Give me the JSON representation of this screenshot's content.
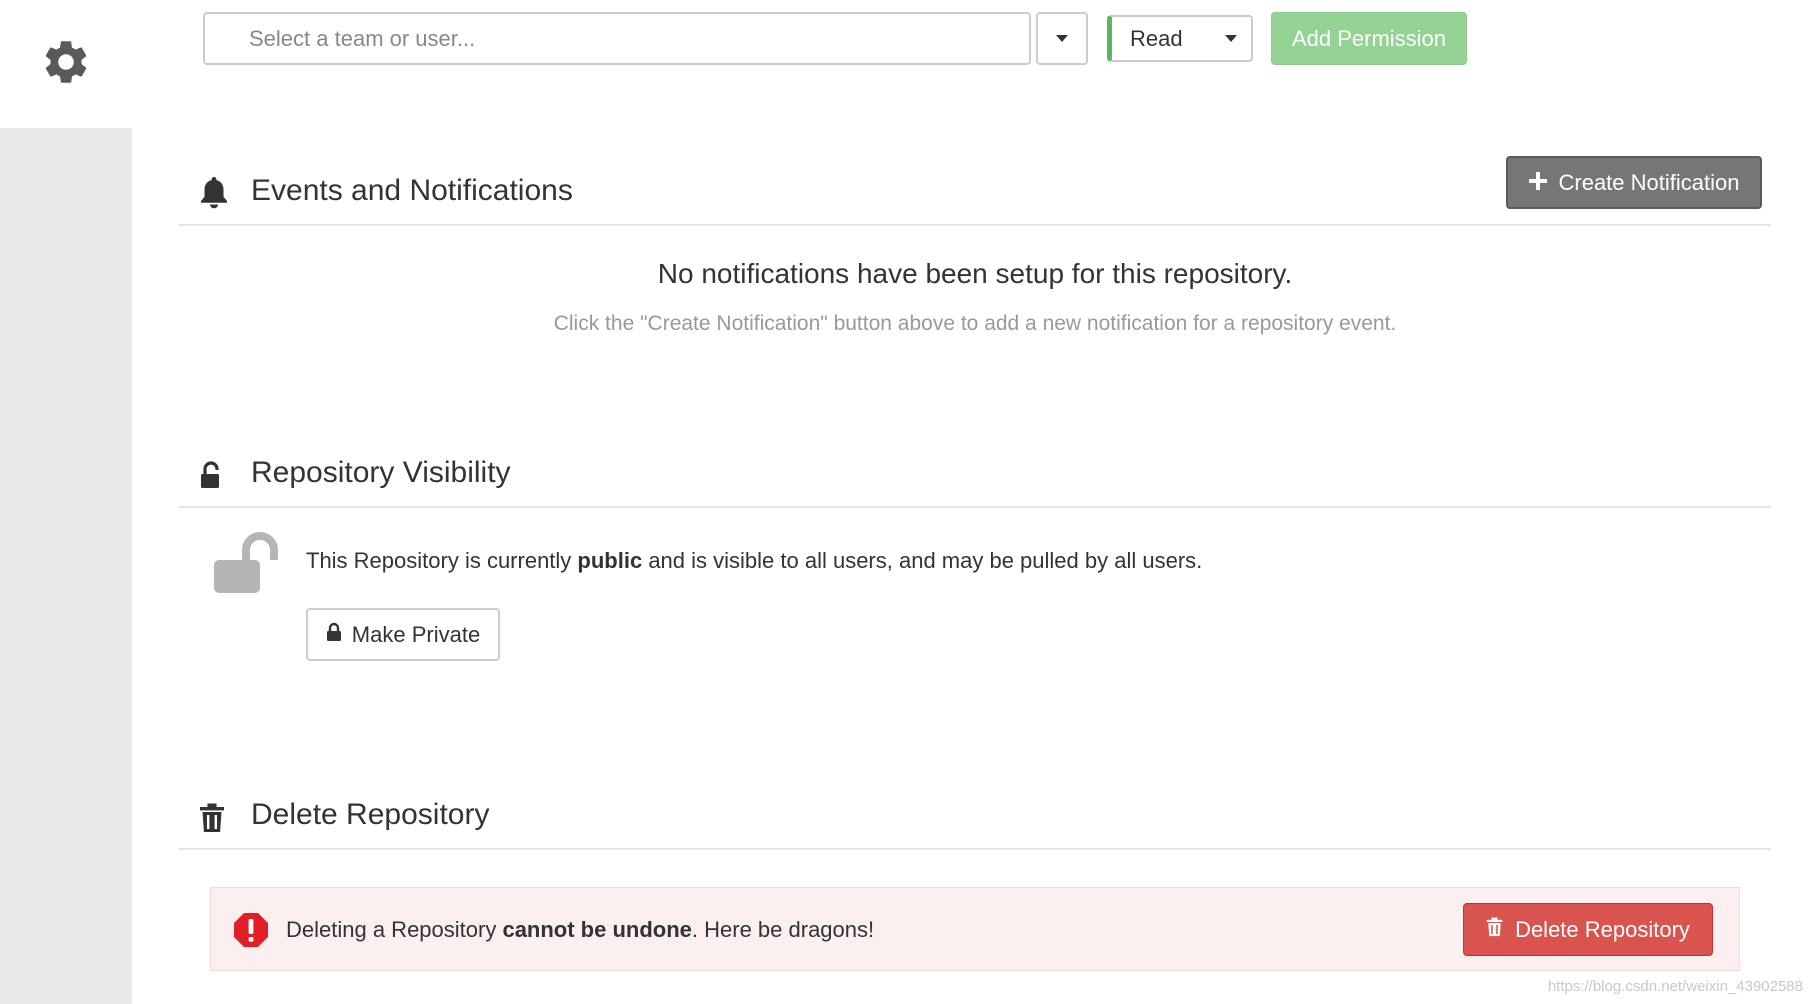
{
  "sidebar": {
    "active_tab_icon": "gear-icon"
  },
  "permissions": {
    "entity_placeholder": "Select a team or user...",
    "role_value": "Read",
    "add_button_label": "Add Permission"
  },
  "notifications": {
    "title": "Events and Notifications",
    "create_button_label": "Create Notification",
    "empty_title": "No notifications have been setup for this repository.",
    "empty_subtitle": "Click the \"Create Notification\" button above to add a new notification for a repository event."
  },
  "visibility": {
    "title": "Repository Visibility",
    "status_prefix": "This Repository is currently ",
    "status_value": "public",
    "status_suffix": " and is visible to all users, and may be pulled by all users.",
    "make_private_label": "Make Private"
  },
  "delete": {
    "title": "Delete Repository",
    "warning_prefix": "Deleting a Repository ",
    "warning_emphasis": "cannot be undone",
    "warning_suffix": ". Here be dragons!",
    "button_label": "Delete Repository"
  },
  "watermark": "https://blog.csdn.net/weixin_43902588",
  "colors": {
    "success": "#5cb85c",
    "success_disabled": "#94d394",
    "danger": "#d9534f",
    "default_dark": "#767676",
    "alert_bg": "#fcefef"
  }
}
